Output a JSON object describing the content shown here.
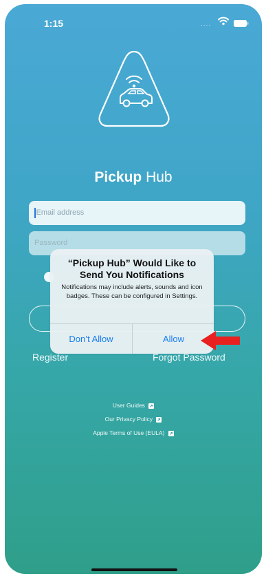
{
  "status_bar": {
    "time": "1:15",
    "signal": "....",
    "icons": [
      "wifi-icon",
      "battery-icon"
    ]
  },
  "app": {
    "name_bold": "Pickup",
    "name_regular": " Hub",
    "logo_icon": "car-wifi-triangle-icon"
  },
  "login": {
    "email_placeholder": "Email address",
    "password_placeholder": "Password",
    "register_label": "Register",
    "forgot_label": "Forgot Password"
  },
  "footer_links": [
    {
      "label": "User Guides",
      "icon": "external-link-icon"
    },
    {
      "label": "Our Privacy Policy",
      "icon": "external-link-icon"
    },
    {
      "label": "Apple Terms of Use (EULA)",
      "icon": "external-link-icon"
    }
  ],
  "alert": {
    "title": "“Pickup Hub” Would Like to Send You Notifications",
    "message": "Notifications may include alerts, sounds and icon badges. These can be configured in Settings.",
    "dont_allow_label": "Don’t Allow",
    "allow_label": "Allow"
  },
  "annotation": {
    "icon": "red-arrow-icon",
    "color": "#e8201f"
  },
  "colors": {
    "gradient_top": "#4aa9d5",
    "gradient_bottom": "#2f9f8a",
    "ios_blue": "#1a7df0"
  }
}
